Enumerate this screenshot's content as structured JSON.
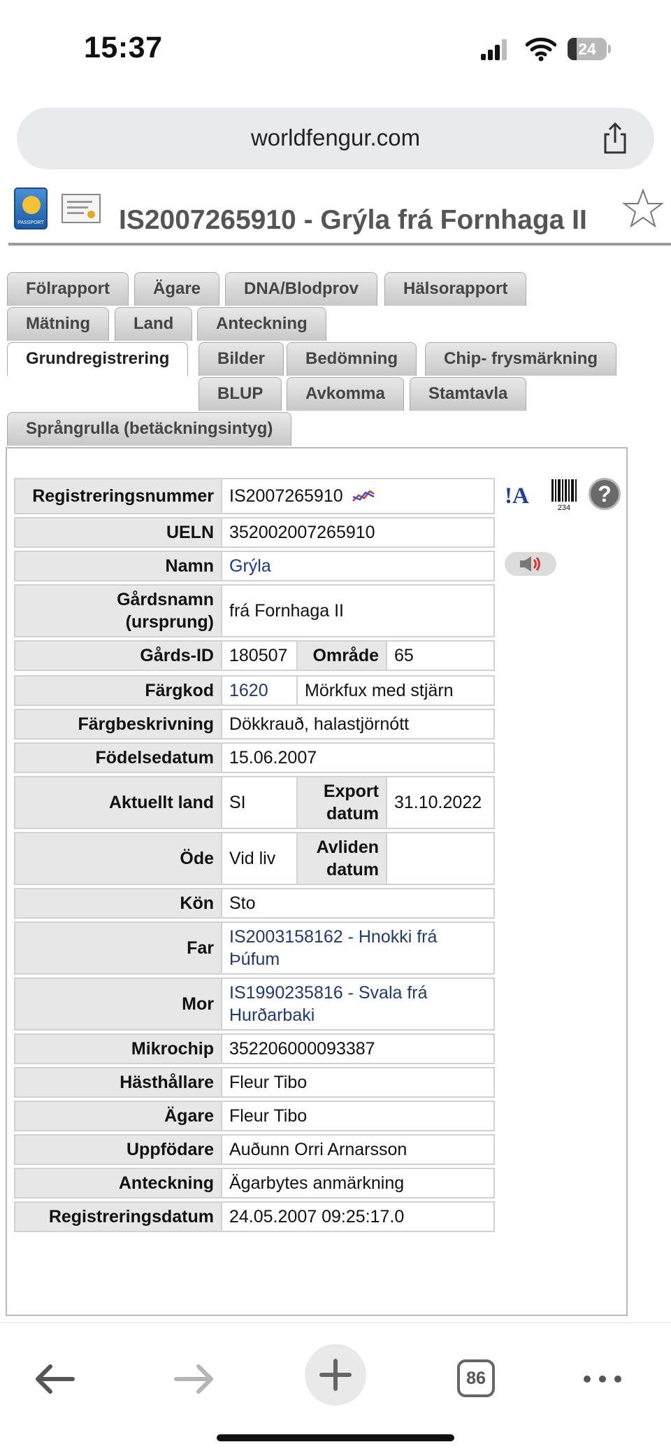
{
  "status_bar": {
    "time": "15:37",
    "battery": "24",
    "battery_fraction": 0.24
  },
  "browser": {
    "url": "worldfengur.com",
    "open_tabs": "86"
  },
  "page": {
    "title": "IS2007265910 - Grýla frá Fornhaga II",
    "passport_label": "PASSPORT",
    "tab_rows": [
      [
        "Fölrapport",
        "Ägare",
        "DNA/Blodprov",
        "Hälsorapport"
      ],
      [
        "Mätning",
        "Land",
        "Anteckning"
      ],
      [
        "Grundregistrering",
        "Bilder",
        "Bedömning",
        "Chip- frysmärkning"
      ],
      [
        "BLUP",
        "Avkomma",
        "Stamtavla"
      ],
      [
        "Språngrulla (betäckningsintyg)"
      ]
    ],
    "active_tab": "Grundregistrering",
    "side_icons": {
      "ia_label": "!A",
      "barcode_number": "234",
      "help_label": "?"
    },
    "fields": {
      "registreringsnummer": {
        "label": "Registreringsnummer",
        "value": "IS2007265910"
      },
      "ueln": {
        "label": "UELN",
        "value": "352002007265910"
      },
      "namn": {
        "label": "Namn",
        "value": "Grýla"
      },
      "gardsnamn": {
        "label_line1": "Gårdsnamn",
        "label_line2": "(ursprung)",
        "value": "frá Fornhaga II"
      },
      "gards_id": {
        "label": "Gårds-ID",
        "value": "180507",
        "omrade_label": "Område",
        "omrade_value": "65"
      },
      "fargkod": {
        "label": "Färgkod",
        "code": "1620",
        "desc": "Mörkfux med stjärn"
      },
      "fargbeskrivning": {
        "label": "Färgbeskrivning",
        "value": "Dökkrauð, halastjörnótt"
      },
      "fodelsedatum": {
        "label": "Födelsedatum",
        "value": "15.06.2007"
      },
      "aktuellt_land": {
        "label": "Aktuellt land",
        "value": "SI",
        "export_label_line1": "Export",
        "export_label_line2": "datum",
        "export_value": "31.10.2022"
      },
      "ode": {
        "label": "Öde",
        "value": "Vid liv",
        "avliden_label_line1": "Avliden",
        "avliden_label_line2": "datum",
        "avliden_value": ""
      },
      "kon": {
        "label": "Kön",
        "value": "Sto"
      },
      "far": {
        "label": "Far",
        "line1": "IS2003158162 - Hnokki frá",
        "line2": "Þúfum"
      },
      "mor": {
        "label": "Mor",
        "line1": "IS1990235816 - Svala frá",
        "line2": "Hurðarbaki"
      },
      "mikrochip": {
        "label": "Mikrochip",
        "value": "352206000093387"
      },
      "hasthallare": {
        "label": "Hästhållare",
        "value": "Fleur Tibo"
      },
      "agare": {
        "label": "Ägare",
        "value": "Fleur Tibo"
      },
      "uppfodare": {
        "label": "Uppfödare",
        "value": "Auðunn Orri Arnarsson"
      },
      "anteckning": {
        "label": "Anteckning",
        "value": "Ägarbytes anmärkning"
      },
      "registreringsdatum": {
        "label": "Registreringsdatum",
        "value": "24.05.2007 09:25:17.0"
      }
    }
  }
}
